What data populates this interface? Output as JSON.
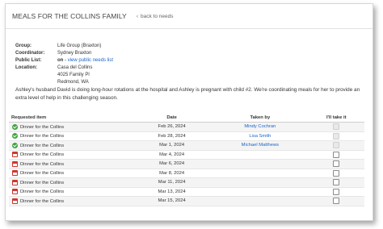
{
  "header": {
    "title": "MEALS FOR THE COLLINS FAMILY",
    "back_link": "back to needs"
  },
  "info": {
    "group_label": "Group:",
    "group_value": "Life Group (Braxton)",
    "coordinator_label": "Coordinator:",
    "coordinator_value": "Sydney Braxton",
    "public_list_label": "Public List:",
    "public_list_status": "on",
    "public_list_separator": " - ",
    "public_list_link": "view public needs list",
    "location_label": "Location:",
    "location_line1": "Casa del Collins",
    "location_line2": "4025 Family Pl",
    "location_line3": "Redmond, WA"
  },
  "description": "Ashley's husband David is doing long-hour rotations at the hospital and Ashley is pregnant with child #2. We're coordinating meals for her to provide an extra level of help in this challenging season.",
  "table": {
    "headers": [
      "Requested item",
      "Date",
      "Taken by",
      "I'll take it"
    ],
    "rows": [
      {
        "status": "taken",
        "item": "Dinner for the Collins",
        "date": "Feb 26, 2024",
        "taken_by": "Mindy Cochran"
      },
      {
        "status": "taken",
        "item": "Dinner for the Collins",
        "date": "Feb 28, 2024",
        "taken_by": "Lisa Smith"
      },
      {
        "status": "taken",
        "item": "Dinner for the Collins",
        "date": "Mar 1, 2024",
        "taken_by": "Michael Matthews"
      },
      {
        "status": "open",
        "item": "Dinner for the Collins",
        "date": "Mar 4, 2024",
        "taken_by": ""
      },
      {
        "status": "open",
        "item": "Dinner for the Collins",
        "date": "Mar 6, 2024",
        "taken_by": ""
      },
      {
        "status": "open",
        "item": "Dinner for the Collins",
        "date": "Mar 8, 2024",
        "taken_by": ""
      },
      {
        "status": "open",
        "item": "Dinner for the Collins",
        "date": "Mar 11, 2024",
        "taken_by": ""
      },
      {
        "status": "open",
        "item": "Dinner for the Collins",
        "date": "Mar 13, 2024",
        "taken_by": ""
      },
      {
        "status": "open",
        "item": "Dinner for the Collins",
        "date": "Mar 15, 2024",
        "taken_by": ""
      }
    ]
  },
  "colors": {
    "link": "#1a66c9",
    "taken_icon": "#3fa33f",
    "open_icon": "#d23a30"
  }
}
